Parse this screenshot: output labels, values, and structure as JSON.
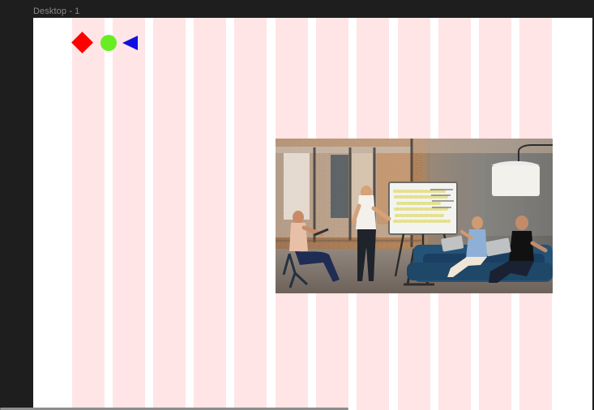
{
  "canvas": {
    "frame_label": "Desktop - 1",
    "background": "#1e1e1e",
    "frame_background": "#ffffff"
  },
  "layout_grid": {
    "column_count": 12,
    "color": "#ff0000",
    "opacity": 0.1
  },
  "shapes": [
    {
      "name": "diamond",
      "color": "#ff0000"
    },
    {
      "name": "circle",
      "color": "#66ee22"
    },
    {
      "name": "triangle",
      "color": "#1010e0"
    }
  ],
  "photo": {
    "subject": "office-meeting-whiteboard"
  }
}
